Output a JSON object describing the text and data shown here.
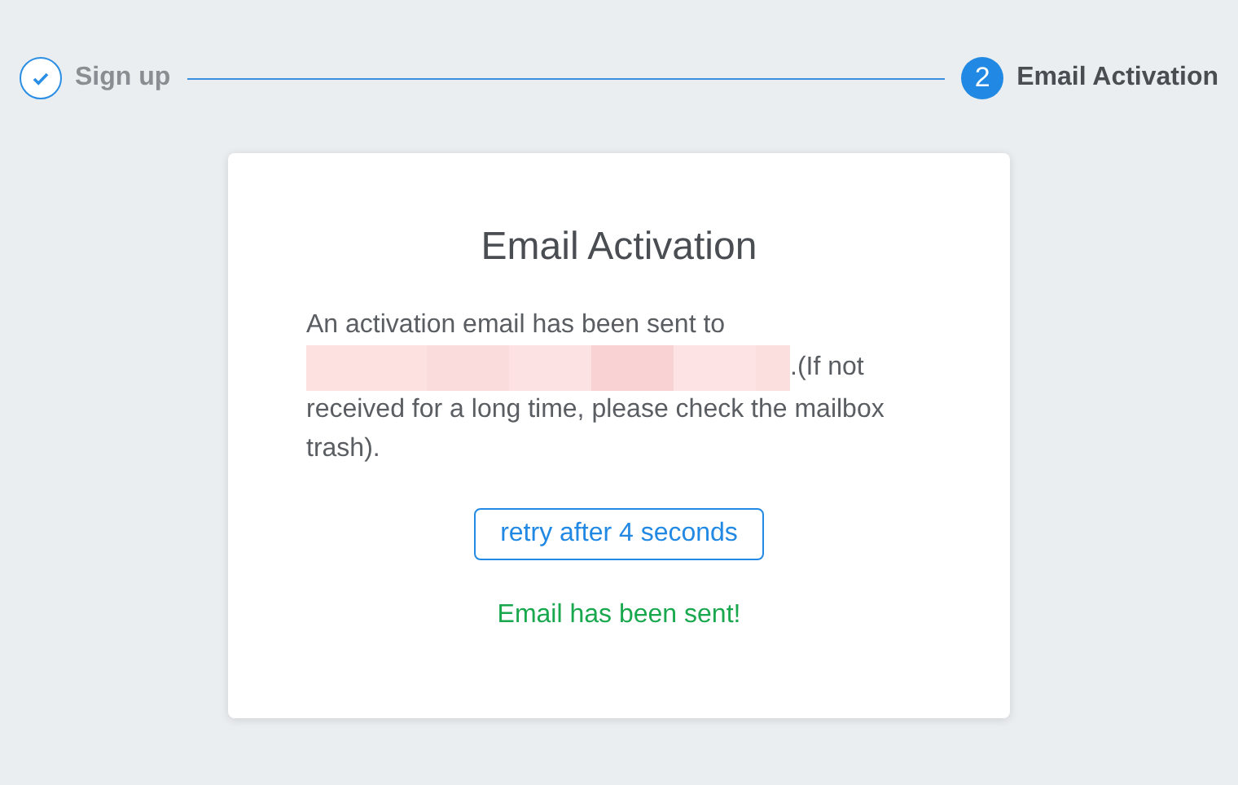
{
  "steps": [
    {
      "label": "Sign up",
      "done": true
    },
    {
      "number": "2",
      "label": "Email Activation",
      "done": false
    }
  ],
  "card": {
    "title": "Email Activation",
    "message_before": "An activation email has been sent to",
    "message_after": ".(If not received for a long time, please check the mailbox trash).",
    "button": {
      "label": "retry after 4 seconds"
    },
    "status_message": "Email has been sent!"
  }
}
